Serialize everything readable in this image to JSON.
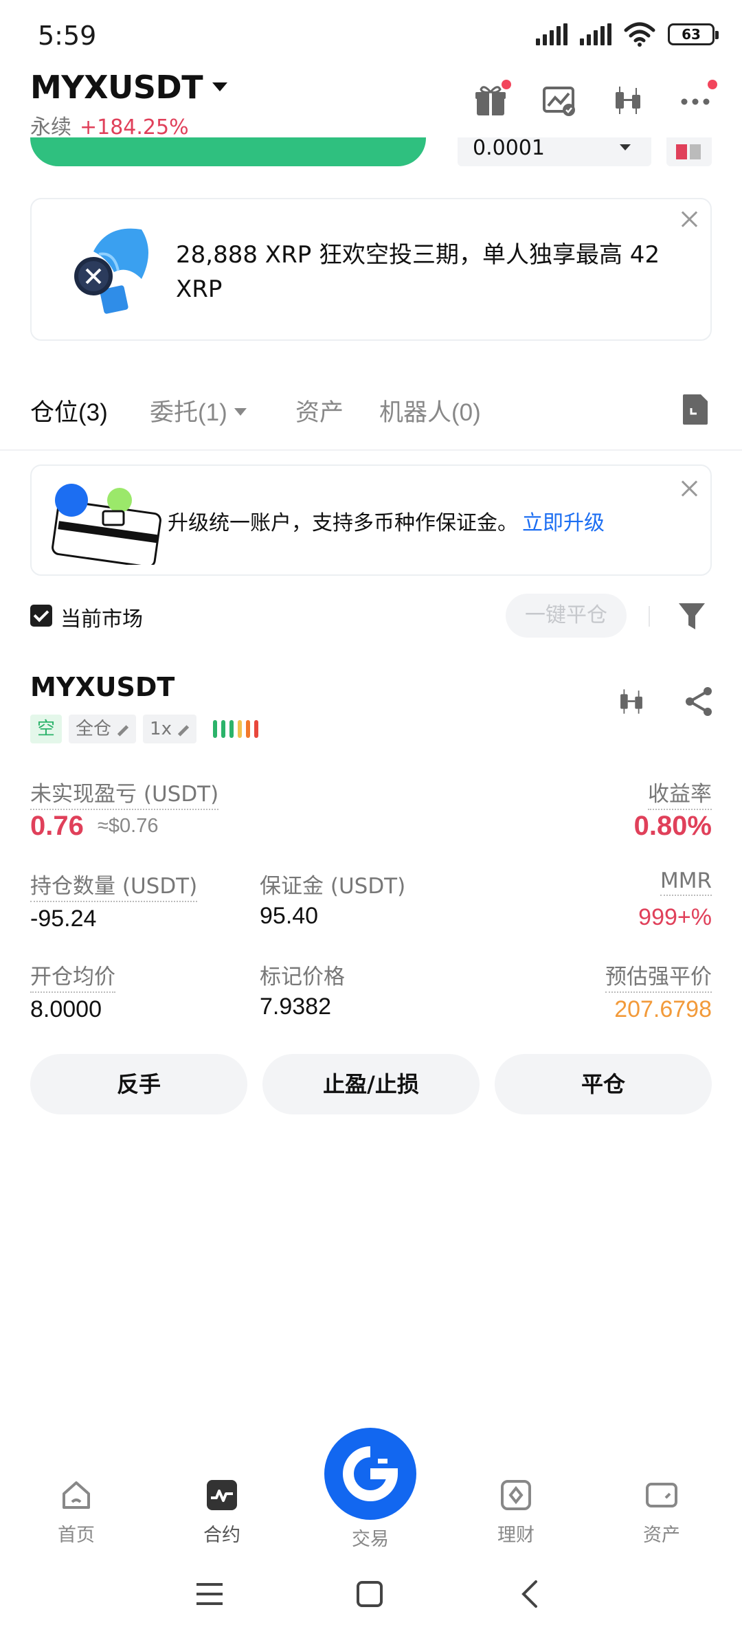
{
  "status_bar": {
    "time": "5:59",
    "battery": "63"
  },
  "header": {
    "symbol": "MYXUSDT",
    "contract_type": "永续",
    "change_pct": "+184.25%"
  },
  "trade_bar": {
    "price_precision": "0.0001"
  },
  "promo": {
    "text": "28,888 XRP 狂欢空投三期，单人独享最高 42 XRP"
  },
  "tabs": [
    {
      "label": "仓位",
      "count": "(3)"
    },
    {
      "label": "委托",
      "count": "(1)"
    },
    {
      "label": "资产",
      "count": ""
    },
    {
      "label": "机器人",
      "count": "(0)"
    }
  ],
  "upgrade": {
    "text": "升级统一账户，支持多币种作保证金。",
    "link": "立即升级"
  },
  "filter": {
    "current_market": "当前市场",
    "close_all": "一键平仓"
  },
  "position": {
    "symbol": "MYXUSDT",
    "side": "空",
    "margin_mode": "全仓",
    "leverage": "1x",
    "unrealized_pnl_label": "未实现盈亏 (USDT)",
    "unrealized_pnl": "0.76",
    "unrealized_pnl_usd": "≈$0.76",
    "roe_label": "收益率",
    "roe": "0.80%",
    "size_label": "持仓数量 (USDT)",
    "size": "-95.24",
    "margin_label": "保证金 (USDT)",
    "margin": "95.40",
    "mmr_label": "MMR",
    "mmr": "999+%",
    "entry_label": "开仓均价",
    "entry": "8.0000",
    "mark_label": "标记价格",
    "mark": "7.9382",
    "liq_label": "预估强平价",
    "liq": "207.6798",
    "buttons": {
      "reverse": "反手",
      "tpsl": "止盈/止损",
      "close": "平仓"
    }
  },
  "bottom_nav": {
    "home": "首页",
    "futures": "合约",
    "trade": "交易",
    "earn": "理财",
    "assets": "资产"
  },
  "colors": {
    "accent": "#1267f0",
    "up_red": "#e0405a",
    "green": "#2fc07f",
    "orange": "#f29a3a"
  }
}
